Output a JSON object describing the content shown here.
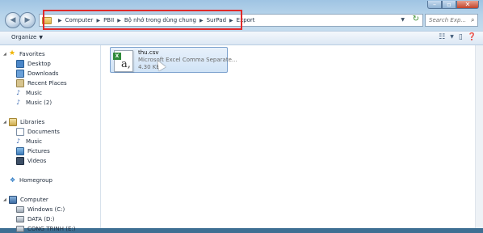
{
  "address": {
    "crumbs": [
      "Computer",
      "PBII",
      "Bộ nhớ trong dùng chung",
      "SurPad",
      "Export"
    ]
  },
  "search": {
    "placeholder": "Search Exp..."
  },
  "toolbar": {
    "organize_label": "Organize"
  },
  "sidebar": {
    "favorites": {
      "header": "Favorites",
      "items": [
        "Desktop",
        "Downloads",
        "Recent Places",
        "Music",
        "Music (2)"
      ]
    },
    "libraries": {
      "header": "Libraries",
      "items": [
        "Documents",
        "Music",
        "Pictures",
        "Videos"
      ]
    },
    "homegroup": "Homegroup",
    "computer": {
      "header": "Computer",
      "items": [
        "Windows (C:)",
        "DATA (D:)",
        "CONG TRINH (E:)"
      ]
    }
  },
  "file": {
    "name": "thu.csv",
    "type": "Microsoft Excel Comma Separate...",
    "size": "4.30 KB",
    "icon": "excel-csv-icon"
  },
  "colors": {
    "highlight": "#e02a2a",
    "selection": "#d0e3f6"
  }
}
